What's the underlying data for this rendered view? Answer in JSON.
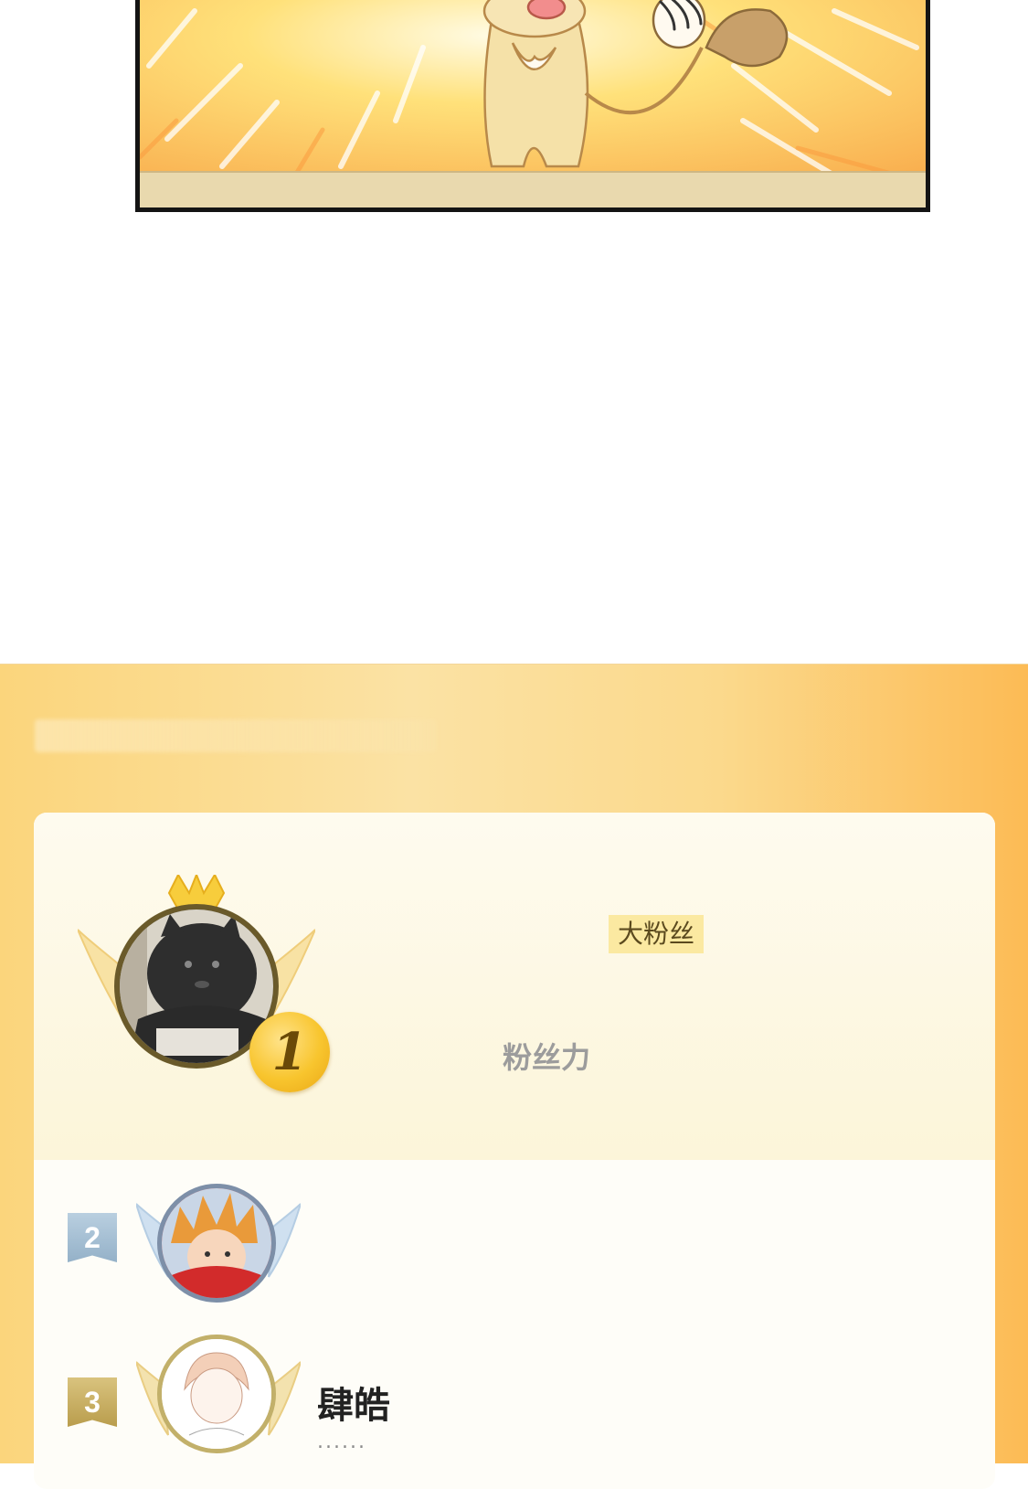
{
  "ranking": {
    "top_fan": {
      "rank": "1",
      "badge": "大粉丝",
      "power_label": "粉丝力"
    },
    "entries": [
      {
        "rank": "2",
        "name": "",
        "subtitle": ""
      },
      {
        "rank": "3",
        "name": "肆皓",
        "subtitle": "......"
      }
    ]
  },
  "colors": {
    "section_bg": "#fbd98c",
    "card_bg": "#fefdf8",
    "medal_gold": "#f8c52e",
    "badge_bg": "#fbe9a1"
  },
  "icons": [
    "crown-icon",
    "wing-icon",
    "rank-medal-icon"
  ]
}
